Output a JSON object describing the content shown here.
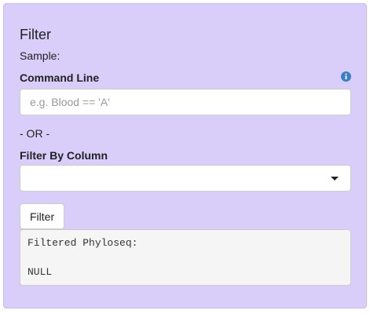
{
  "panel": {
    "title": "Filter",
    "sample_label": "Sample:",
    "command_line_label": "Command Line",
    "command_input": {
      "value": "",
      "placeholder": "e.g. Blood == 'A'"
    },
    "info_icon": "info-circle-icon",
    "or_separator": "- OR -",
    "filter_by_column_label": "Filter By Column",
    "column_select": {
      "selected": ""
    },
    "filter_button_label": "Filter",
    "output_text": "Filtered Phyloseq:\n\nNULL"
  },
  "colors": {
    "panel_bg": "#d9cdfa",
    "info_icon": "#3a7fc4"
  }
}
